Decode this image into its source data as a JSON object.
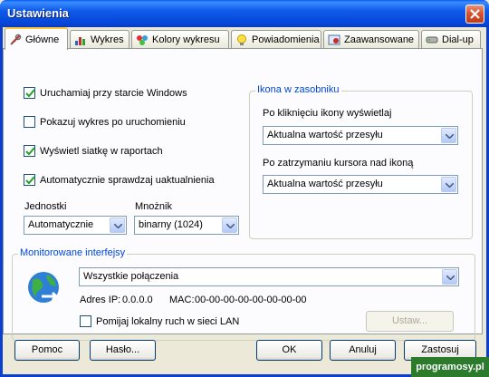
{
  "window": {
    "title": "Ustawienia"
  },
  "tabs": [
    {
      "label": "Główne",
      "icon": "tools-icon"
    },
    {
      "label": "Wykres",
      "icon": "chart-icon"
    },
    {
      "label": "Kolory wykresu",
      "icon": "palette-icon"
    },
    {
      "label": "Powiadomienia",
      "icon": "lightbulb-icon"
    },
    {
      "label": "Zaawansowane",
      "icon": "settings-icon"
    },
    {
      "label": "Dial-up",
      "icon": "modem-icon"
    }
  ],
  "general": {
    "checkboxes": [
      {
        "label": "Uruchamiaj przy starcie Windows",
        "checked": true
      },
      {
        "label": "Pokazuj wykres po uruchomieniu",
        "checked": false
      },
      {
        "label": "Wyświetl siatkę w raportach",
        "checked": true
      },
      {
        "label": "Automatycznie sprawdzaj uaktualnienia",
        "checked": true
      }
    ],
    "units_label": "Jednostki",
    "units_value": "Automatycznie",
    "multiplier_label": "Mnożnik",
    "multiplier_value": "binarny (1024)"
  },
  "tray": {
    "title": "Ikona w zasobniku",
    "click_label": "Po kliknięciu ikony wyświetlaj",
    "click_value": "Aktualna wartość przesyłu",
    "hover_label": "Po zatrzymaniu kursora nad ikoną",
    "hover_value": "Aktualna wartość przesyłu"
  },
  "interfaces": {
    "title": "Monitorowane interfejsy",
    "selected": "Wszystkie połączenia",
    "ip_label": "Adres IP:",
    "ip_value": "0.0.0.0",
    "mac_label": "MAC:",
    "mac_value": "00-00-00-00-00-00-00-00",
    "ignore_lan_label": "Pomijaj lokalny ruch w sieci LAN",
    "ignore_lan_checked": false,
    "settings_button": "Ustaw..."
  },
  "footer": {
    "help": "Pomoc",
    "password": "Hasło...",
    "ok": "OK",
    "cancel": "Anuluj",
    "apply": "Zastosuj"
  },
  "watermark": "programosy.pl",
  "colors": {
    "title_bar": "#0a5cf4",
    "group_title": "#0046d5",
    "face": "#ece9d8"
  }
}
